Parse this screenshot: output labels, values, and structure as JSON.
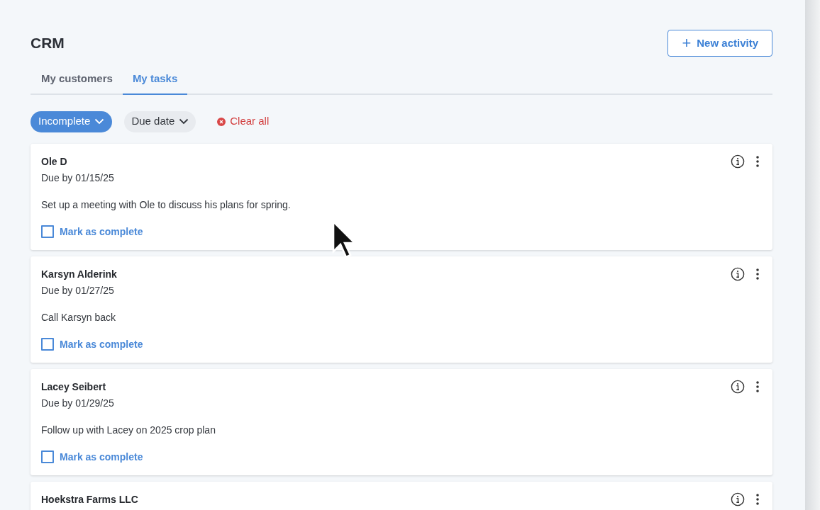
{
  "page_title": "CRM",
  "new_activity_button": {
    "icon": "+",
    "label": "New activity"
  },
  "tabs": [
    {
      "label": "My customers",
      "selected": false
    },
    {
      "label": "My tasks",
      "selected": true
    }
  ],
  "filters": [
    {
      "label": "Incomplete",
      "selected": true
    },
    {
      "label": "Due date",
      "selected": false
    }
  ],
  "clear_all": "Clear all",
  "tasks": [
    {
      "name": "Ole D",
      "due": "Due by 01/15/25",
      "description": "Set up a meeting with Ole to discuss his plans for spring.",
      "checked": false,
      "action": "Mark as complete"
    },
    {
      "name": "Karsyn Alderink",
      "due": "Due by 01/27/25",
      "description": "Call Karsyn back",
      "checked": false,
      "action": "Mark as complete"
    },
    {
      "name": "Lacey Seibert",
      "due": "Due by 01/29/25",
      "description": "Follow up with Lacey on 2025 crop plan",
      "checked": false,
      "action": "Mark as complete"
    },
    {
      "name": "Hoekstra Farms LLC"
    }
  ]
}
